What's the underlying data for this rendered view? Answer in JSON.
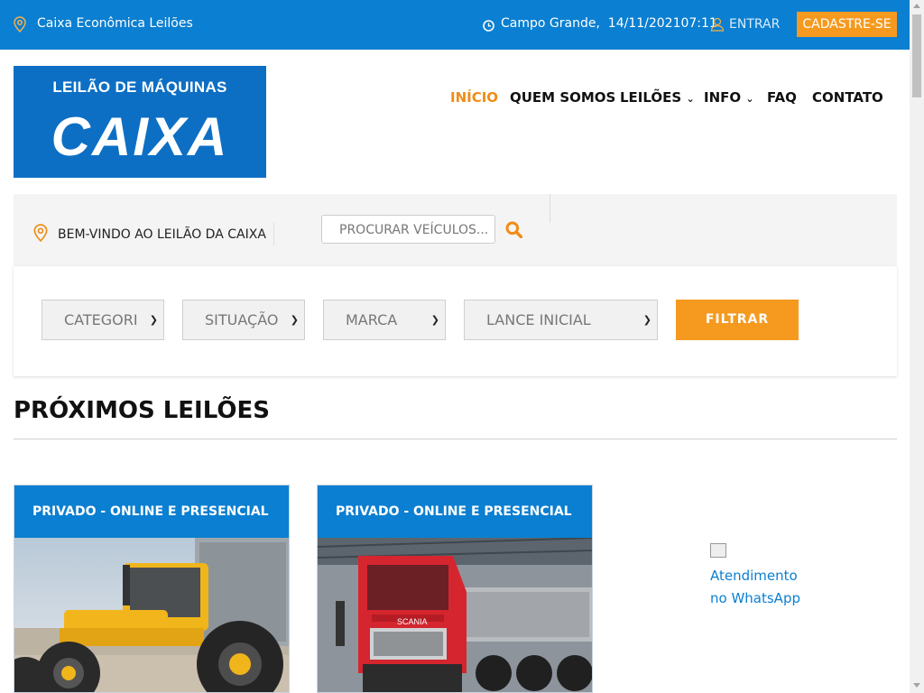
{
  "topbar": {
    "brand": "Caixa Econômica Leilões",
    "location_datetime": "Campo Grande,  14/11/202107:11",
    "login": "ENTRAR",
    "signup": "CADASTRE-SE"
  },
  "logo": {
    "subtitle": "LEILÃO DE MÁQUINAS",
    "title": "CAIXA"
  },
  "nav": {
    "items": [
      "INÍCIO",
      "QUEM SOMOS",
      "LEILÕES",
      "INFO",
      "FAQ",
      "CONTATO"
    ]
  },
  "band": {
    "welcome": "BEM-VINDO AO LEILÃO DA CAIXA",
    "search_placeholder": "PROCURAR VEÍCULOS..."
  },
  "filters": {
    "categoria": "CATEGORI",
    "situacao": "SITUAÇÃO",
    "marca": "MARCA",
    "lance": "LANCE INICIAL",
    "button": "FILTRAR"
  },
  "section": {
    "title": "PRÓXIMOS LEILÕES"
  },
  "cards": [
    {
      "label": "PRIVADO - ONLINE E PRESENCIAL",
      "image": "yellow tractor"
    },
    {
      "label": "PRIVADO - ONLINE E PRESENCIAL",
      "image": "red truck"
    }
  ],
  "whatsapp": {
    "alt": "Atendimento no WhatsApp"
  },
  "colors": {
    "primary": "#0b7fd1",
    "accent": "#f59a1f",
    "active_nav": "#f08c16"
  }
}
